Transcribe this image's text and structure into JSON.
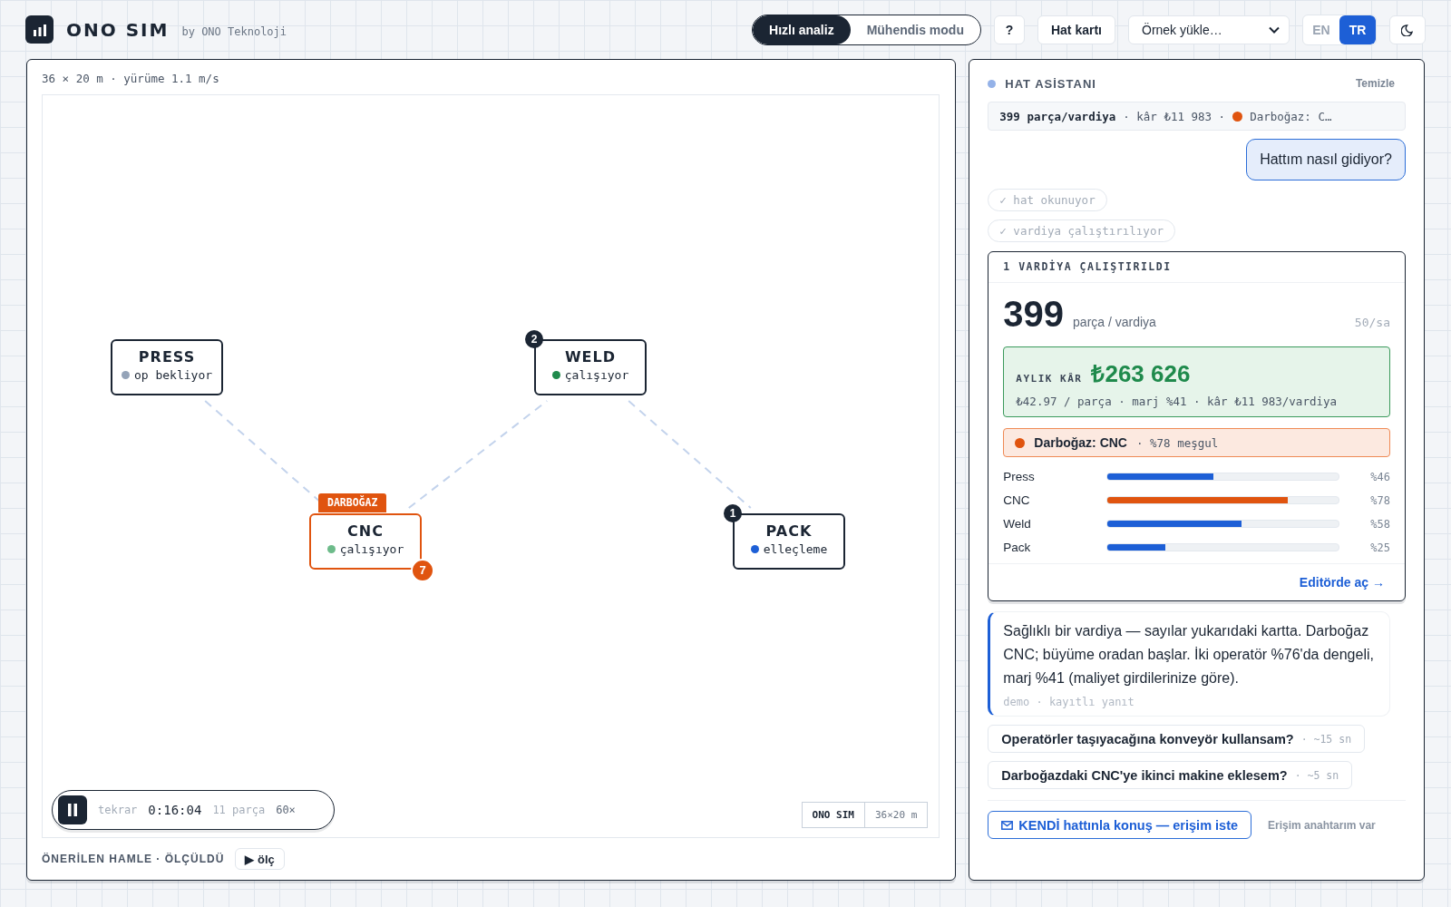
{
  "header": {
    "app_name": "ONO SIM",
    "byline": "by ONO Teknoloji",
    "modes": [
      {
        "label": "Hızlı analiz",
        "selected": true
      },
      {
        "label": "Mühendis modu",
        "selected": false
      }
    ],
    "help_button": "?",
    "card_button": "Hat kartı",
    "example_select": "Örnek yükle…",
    "languages": [
      {
        "label": "EN",
        "selected": false
      },
      {
        "label": "TR",
        "selected": true
      }
    ]
  },
  "floor": {
    "caption": "36 × 20 m · yürüme 1.1 m/s",
    "stations": [
      {
        "name": "PRESS",
        "status": "op bekliyor",
        "color": "#94a3b8",
        "bottleneck": false
      },
      {
        "name": "CNC",
        "status": "çalışıyor",
        "color": "#6dbb8a",
        "bottleneck": true,
        "tag": "DARBOĞAZ",
        "queue": "7"
      },
      {
        "name": "WELD",
        "status": "çalışıyor",
        "color": "#1f8a4c",
        "bottleneck": false,
        "operators": "2"
      },
      {
        "name": "PACK",
        "status": "elleçleme",
        "color": "#1d5fd6",
        "bottleneck": false,
        "operators": "1"
      }
    ],
    "playback": {
      "playing": true,
      "mode": "tekrar",
      "clock": "0:16:04",
      "parts": "11 parça",
      "speed": "60×"
    },
    "stamp": {
      "brand": "ONO SIM",
      "size": "36×20 m"
    },
    "footer": {
      "label": "ÖNERİLEN HAMLE · ÖLÇÜLDÜ",
      "button": "▶ ölç"
    }
  },
  "assistant": {
    "title": "HAT ASİSTANI",
    "clear": "Temizle",
    "summary": {
      "throughput": "399 parça/vardiya",
      "profit": "· kâr ₺11 983 ·",
      "bottleneck": "Darboğaz: C…"
    },
    "user_message": "Hattım nasıl gidiyor?",
    "steps": [
      "✓ hat okunuyor",
      "✓ vardiya çalıştırılıyor"
    ],
    "result": {
      "title": "1 VARDİYA ÇALIŞTIRILDI",
      "value": "399",
      "unit": "parça / vardiya",
      "rate": "50/sa",
      "profit_label": "AYLIK KÂR",
      "profit_value": "₺263 626",
      "profit_detail": "₺42.97 / parça · marj %41 · kâr ₺11 983/vardiya",
      "bottleneck_name": "Darboğaz: CNC",
      "bottleneck_detail": "· %78 meşgul",
      "utilization": [
        {
          "name": "Press",
          "level": 0.46,
          "reading": "%46",
          "color": "#1d5fd6"
        },
        {
          "name": "CNC",
          "level": 0.78,
          "reading": "%78",
          "color": "#e0540f"
        },
        {
          "name": "Weld",
          "level": 0.58,
          "reading": "%58",
          "color": "#1d5fd6"
        },
        {
          "name": "Pack",
          "level": 0.25,
          "reading": "%25",
          "color": "#1d5fd6"
        }
      ],
      "open_link": "Editörde aç →"
    },
    "reply": {
      "text": "Sağlıklı bir vardiya — sayılar yukarıdaki kartta. Darboğaz CNC; büyüme oradan başlar. İki operatör %76'da dengeli, marj %41 (maliyet girdilerinize göre).",
      "meta": "demo · kayıtlı yanıt"
    },
    "suggestions": [
      {
        "question": "Operatörler taşıyacağına konveyör kullansam?",
        "time": "· ~15 sn"
      },
      {
        "question": "Darboğazdaki CNC'ye ikinci makine eklesem?",
        "time": "· ~5 sn"
      }
    ],
    "access_button": "KENDİ hattınla konuş — erişim iste",
    "key_link": "Erişim anahtarım var"
  }
}
